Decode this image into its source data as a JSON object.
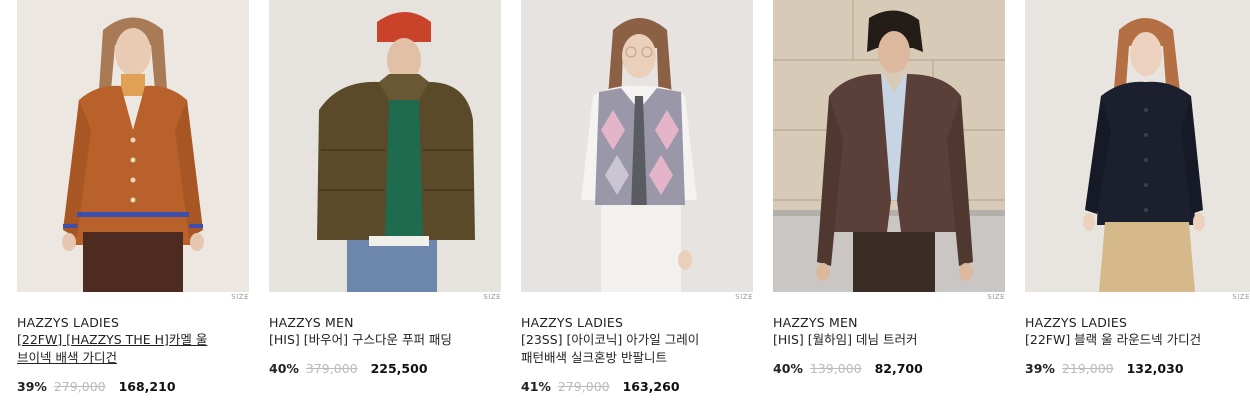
{
  "products": [
    {
      "brand": "HAZZYS LADIES",
      "name": "[22FW] [HAZZYS THE H]카멜 울 브이넥 배색 가디건",
      "discount": "39%",
      "original_price": "279,000",
      "final_price": "168,210",
      "size_label": "SIZE"
    },
    {
      "brand": "HAZZYS MEN",
      "name": "[HIS] [바우어] 구스다운 푸퍼 패딩",
      "discount": "40%",
      "original_price": "379,000",
      "final_price": "225,500",
      "size_label": "SIZE"
    },
    {
      "brand": "HAZZYS LADIES",
      "name": "[23SS] [아이코닉] 아가일 그레이 패턴배색 실크혼방 반팔니트",
      "discount": "41%",
      "original_price": "279,000",
      "final_price": "163,260",
      "size_label": "SIZE"
    },
    {
      "brand": "HAZZYS MEN",
      "name": "[HIS] [월하임] 데님 트러커",
      "discount": "40%",
      "original_price": "139,000",
      "final_price": "82,700",
      "size_label": "SIZE"
    },
    {
      "brand": "HAZZYS LADIES",
      "name": "[22FW] 블랙 울 라운드넥 가디건",
      "discount": "39%",
      "original_price": "219,000",
      "final_price": "132,030",
      "size_label": "SIZE"
    }
  ],
  "colors": {
    "strike": "#bbbbbb",
    "text": "#222222"
  }
}
